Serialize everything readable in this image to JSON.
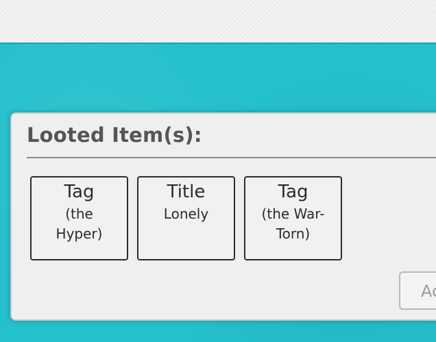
{
  "panel": {
    "title": "Looted Item(s):",
    "items": [
      {
        "type": "Tag",
        "name": "(the Hyper)"
      },
      {
        "type": "Title",
        "name": "Lonely"
      },
      {
        "type": "Tag",
        "name": "(the War-Torn)"
      }
    ],
    "action_button_label": "Ac"
  },
  "colors": {
    "background_teal": "#24c0cc",
    "panel_background": "#efefef",
    "title_text": "#555555",
    "card_border": "#2b2b2b"
  }
}
